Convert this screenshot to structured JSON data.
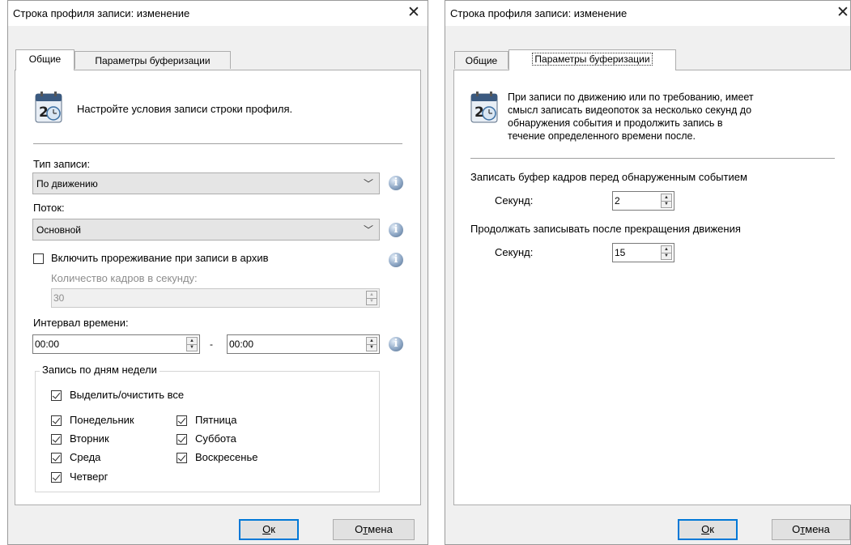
{
  "left": {
    "window_title": "Строка профиля записи: изменение",
    "tabs": [
      {
        "label": "Общие"
      },
      {
        "label": "Параметры буферизации"
      }
    ],
    "intro_text": "Настройте условия записи строки профиля.",
    "record_type": {
      "label": "Тип записи:",
      "value": "По движению"
    },
    "stream": {
      "label": "Поток:",
      "value": "Основной"
    },
    "thinning": {
      "label": "Включить прореживание при записи в архив",
      "checked": false
    },
    "fps": {
      "label": "Количество кадров в секунду:",
      "value": "30"
    },
    "interval": {
      "label": "Интервал времени:",
      "from": "00:00",
      "separator": "-",
      "to": "00:00"
    },
    "weekdays": {
      "group_label": "Запись по дням недели",
      "select_all": {
        "label": "Выделить/очистить все",
        "checked": true
      },
      "days": [
        {
          "label": "Понедельник",
          "checked": true
        },
        {
          "label": "Вторник",
          "checked": true
        },
        {
          "label": "Среда",
          "checked": true
        },
        {
          "label": "Четверг",
          "checked": true
        },
        {
          "label": "Пятница",
          "checked": true
        },
        {
          "label": "Суббота",
          "checked": true
        },
        {
          "label": "Воскресенье",
          "checked": true
        }
      ]
    },
    "ok": {
      "mnemonic": "О",
      "rest": "к"
    },
    "cancel": {
      "pre": "О",
      "mnemonic": "т",
      "rest": "мена"
    }
  },
  "right": {
    "window_title": "Строка профиля записи: изменение",
    "tabs": [
      {
        "label": "Общие"
      },
      {
        "label": "Параметры буферизации"
      }
    ],
    "intro_lines": [
      "При записи по движению или по требованию, имеет",
      "смысл записать видеопоток за несколько секунд до",
      "обнаружения события и продолжить запись в",
      "течение определенного времени после."
    ],
    "pre_buffer": {
      "label": "Записать буфер кадров перед обнаруженным событием",
      "seconds_label": "Секунд:",
      "value": "2"
    },
    "post_record": {
      "label": "Продолжать записывать после прекращения движения",
      "seconds_label": "Секунд:",
      "value": "15"
    },
    "ok": {
      "mnemonic": "О",
      "rest": "к"
    },
    "cancel": {
      "pre": "О",
      "mnemonic": "т",
      "rest": "мена"
    }
  },
  "icons": {
    "close": "close-icon",
    "calendar": "calendar-clock-icon",
    "info": "info-icon",
    "chevron": "chevron-down-icon"
  },
  "colors": {
    "dialog_bg": "#f0f0f0",
    "panel_bg": "#ffffff",
    "default_button_border": "#0078d7",
    "disabled_text": "#8d8d8d"
  }
}
